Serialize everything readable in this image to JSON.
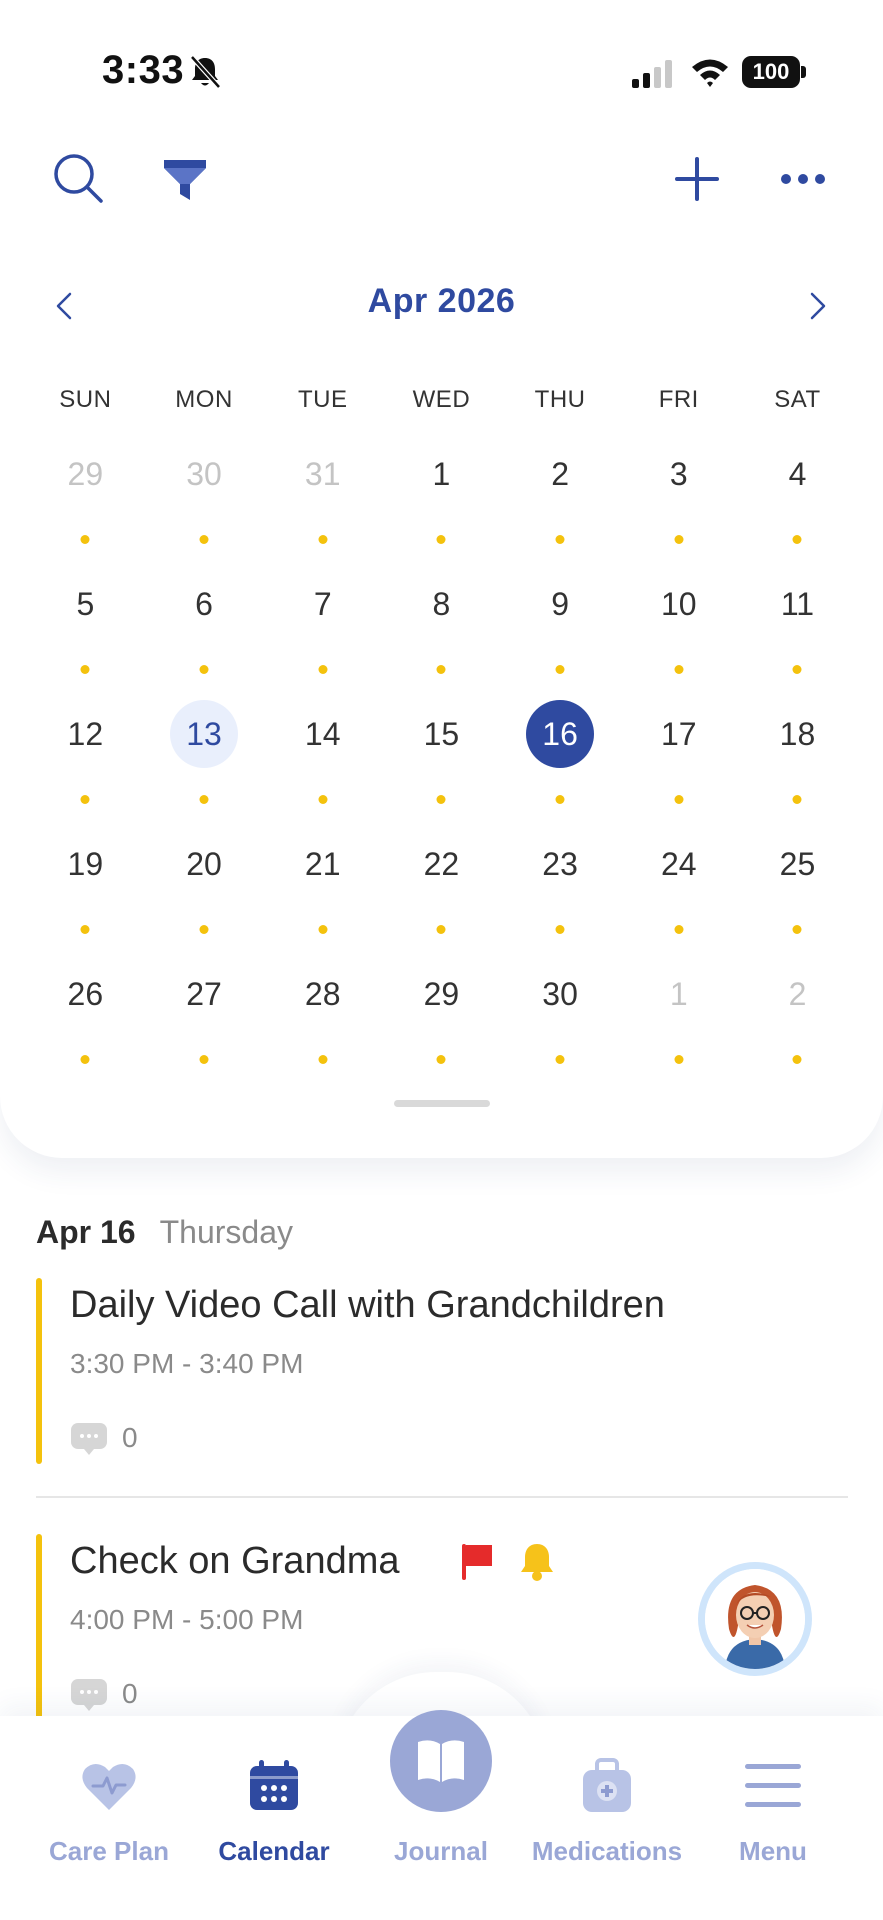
{
  "status_bar": {
    "time": "3:33",
    "battery": "100"
  },
  "toolbar": {
    "search_icon": "search-icon",
    "filter_icon": "filter-icon",
    "add_icon": "plus-icon",
    "more_icon": "more-icon"
  },
  "calendar": {
    "month_title": "Apr 2026",
    "weekdays": [
      "SUN",
      "MON",
      "TUE",
      "WED",
      "THU",
      "FRI",
      "SAT"
    ],
    "weeks": [
      [
        {
          "n": "29",
          "muted": true
        },
        {
          "n": "30",
          "muted": true
        },
        {
          "n": "31",
          "muted": true
        },
        {
          "n": "1"
        },
        {
          "n": "2"
        },
        {
          "n": "3"
        },
        {
          "n": "4"
        }
      ],
      [
        {
          "n": "5"
        },
        {
          "n": "6"
        },
        {
          "n": "7"
        },
        {
          "n": "8"
        },
        {
          "n": "9"
        },
        {
          "n": "10"
        },
        {
          "n": "11"
        }
      ],
      [
        {
          "n": "12"
        },
        {
          "n": "13",
          "today": true
        },
        {
          "n": "14"
        },
        {
          "n": "15"
        },
        {
          "n": "16",
          "selected": true
        },
        {
          "n": "17"
        },
        {
          "n": "18"
        }
      ],
      [
        {
          "n": "19"
        },
        {
          "n": "20"
        },
        {
          "n": "21"
        },
        {
          "n": "22"
        },
        {
          "n": "23"
        },
        {
          "n": "24"
        },
        {
          "n": "25"
        }
      ],
      [
        {
          "n": "26"
        },
        {
          "n": "27"
        },
        {
          "n": "28"
        },
        {
          "n": "29"
        },
        {
          "n": "30"
        },
        {
          "n": "1",
          "muted": true
        },
        {
          "n": "2",
          "muted": true
        }
      ]
    ],
    "colors": {
      "accent": "#2f4aa0",
      "today_bg": "#e9effc",
      "event_dot": "#f4c20d",
      "muted_text": "#c4c4c4"
    }
  },
  "agenda": {
    "date": "Apr 16",
    "weekday": "Thursday",
    "events": [
      {
        "title": "Daily Video Call with Grandchildren",
        "time": "3:30 PM - 3:40 PM",
        "comments": "0",
        "bar_color": "#f4c20d"
      },
      {
        "title": "Check on Grandma",
        "time": "4:00 PM - 5:00 PM",
        "comments": "0",
        "bar_color": "#f4c20d",
        "flag_icon": "red-flag-icon",
        "reminder_icon": "bell-icon"
      }
    ]
  },
  "bottom_nav": {
    "items": [
      {
        "label": "Care Plan",
        "icon": "heart-pulse-icon"
      },
      {
        "label": "Calendar",
        "icon": "calendar-icon",
        "active": true
      },
      {
        "label": "Journal",
        "icon": "book-icon"
      },
      {
        "label": "Medications",
        "icon": "medical-bag-icon"
      },
      {
        "label": "Menu",
        "icon": "hamburger-menu-icon"
      }
    ]
  }
}
